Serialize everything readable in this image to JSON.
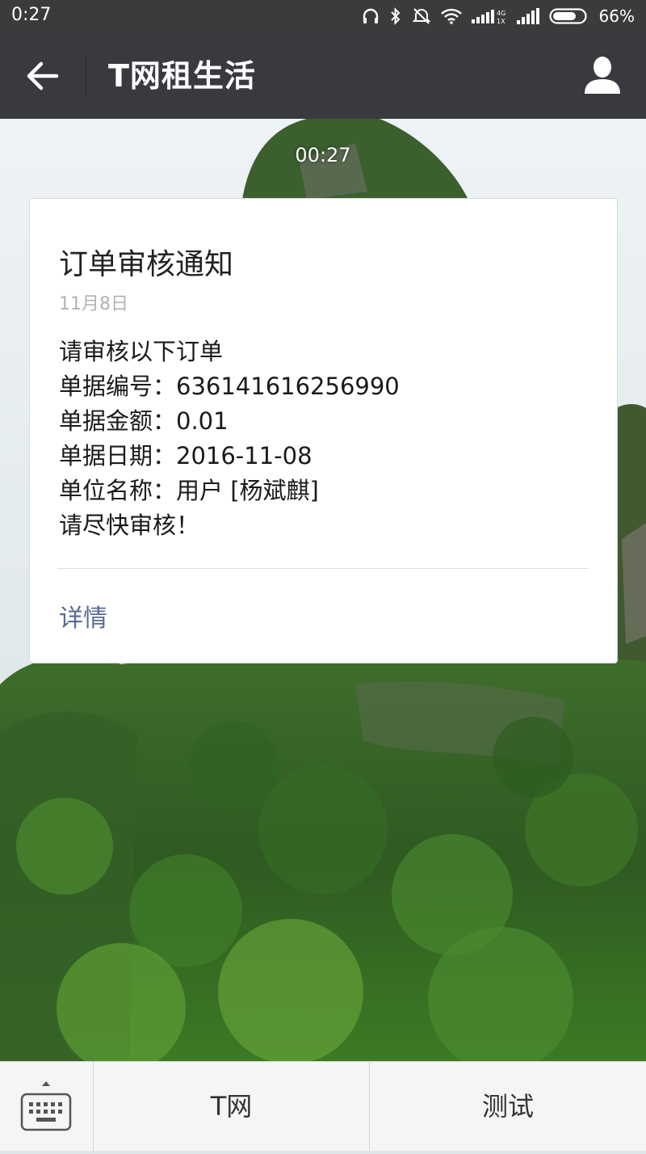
{
  "status_bar": {
    "time": "0:27",
    "battery": "66%",
    "icons": [
      "headphones-icon",
      "bluetooth-icon",
      "mute-icon",
      "wifi-icon",
      "signal-4g-icon",
      "signal-icon",
      "battery-icon"
    ]
  },
  "header": {
    "title": "T网租生活",
    "back_icon": "arrow-left-icon",
    "profile_icon": "person-icon"
  },
  "chat": {
    "timestamp": "00:27",
    "message": {
      "title": "订单审核通知",
      "date": "11月8日",
      "lines": [
        "请审核以下订单",
        "单据编号：636141616256990",
        "单据金额：0.01",
        "单据日期：2016-11-08",
        "单位名称：用户 [杨斌麒]",
        "请尽快审核！"
      ],
      "detail_link": "详情"
    }
  },
  "bottom_menu": {
    "keyboard_icon": "keyboard-icon",
    "items": [
      {
        "label": "T网"
      },
      {
        "label": "测试"
      }
    ]
  },
  "colors": {
    "status_bar": "#3a3b3d",
    "title_bar": "#393a3f",
    "link": "#576b95",
    "date": "#b2b2b2"
  }
}
